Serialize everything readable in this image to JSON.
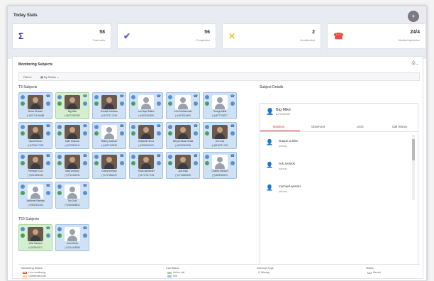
{
  "header": {
    "title": "Today Stats"
  },
  "stats": [
    {
      "icon": "sigma-icon",
      "glyph": "Σ",
      "color": "#2f3a8f",
      "value": "58",
      "label": "Total calls"
    },
    {
      "icon": "check-icon",
      "glyph": "✔",
      "color": "#6a5acd",
      "value": "56",
      "label": "Completed"
    },
    {
      "icon": "missed-call-icon",
      "glyph": "✕",
      "color": "#f0c330",
      "value": "2",
      "label": "Unattended"
    },
    {
      "icon": "phone-active-icon",
      "glyph": "☎",
      "color": "#e74c3c",
      "value": "24/4",
      "label": "Monitoring/Active"
    }
  ],
  "monitoring": {
    "title": "Monitoring Subjects",
    "filters_label": "Filters:",
    "filter_value": "By Status"
  },
  "t3": {
    "title": "T3 Subjects",
    "subjects": [
      {
        "name": "Bruno Richard",
        "number": "(+)972716 66488",
        "green": false,
        "real": true
      },
      {
        "name": "Big Mike",
        "number": "(+)9172930782",
        "green": true,
        "real": true
      },
      {
        "name": "Ronald Goldman",
        "number": "(+)972717 2100",
        "green": false,
        "real": true
      },
      {
        "name": "Lee Boyd Malvo",
        "number": "(+)4874392289",
        "green": false,
        "real": false
      },
      {
        "name": "John Muhammad",
        "number": "(+)4873910455",
        "green": false,
        "real": false
      },
      {
        "name": "George Millie",
        "number": "(+)4877728227",
        "green": false,
        "real": false
      },
      {
        "name": "Nicole Brown",
        "number": "(+)972943 7299",
        "green": false,
        "real": true
      },
      {
        "name": "Katie Simpson",
        "number": "(+)9722816111",
        "green": false,
        "real": true
      },
      {
        "name": "Britney Jackson",
        "number": "(+)4874763228",
        "green": false,
        "real": false
      },
      {
        "name": "Elizabeth Short",
        "number": "(+)5319601122",
        "green": false,
        "real": true
      },
      {
        "name": "Meryah Black Selda",
        "number": "(+)5319381288",
        "green": false,
        "real": true
      },
      {
        "name": "Ted Cruz",
        "number": "(+)5318721 200",
        "green": false,
        "real": true
      },
      {
        "name": "Penelope Cruz",
        "number": "(+)5312891544",
        "green": false,
        "real": true
      },
      {
        "name": "Mary Anthony",
        "number": "(+)2712460011",
        "green": false,
        "real": true
      },
      {
        "name": "Casey Anthony",
        "number": "(+)2717882122",
        "green": false,
        "real": true
      },
      {
        "name": "Travis Alexander",
        "number": "(+)2717917 233",
        "green": false,
        "real": true
      },
      {
        "name": "Jodi Arias",
        "number": "(+)2713883155",
        "green": false,
        "real": true
      },
      {
        "name": "Charles Manson",
        "number": "(+)2839354220",
        "green": false,
        "real": false
      },
      {
        "name": "JonBenet Ramsey",
        "number": "(+)2833311344",
        "green": false,
        "real": false
      },
      {
        "name": "Ted Gold",
        "number": "(+)2834566812",
        "green": false,
        "real": false
      }
    ]
  },
  "t50": {
    "title": "T50 Subjects",
    "subjects": [
      {
        "name": "John Dawson",
        "number": "(+)312843171",
        "green": true,
        "real": true
      },
      {
        "name": "Josh Martin",
        "number": "(+)3214445555",
        "green": false,
        "real": false
      }
    ]
  },
  "details": {
    "title": "Subject Details",
    "name": "Big Mike",
    "number": "9172930782",
    "tabs": [
      "Monitors",
      "Observers",
      "LIOS",
      "Call History"
    ],
    "monitors": [
      {
        "name": "isaque.a.leite",
        "role": "primary"
      },
      {
        "name": "rick.zemlok",
        "role": "backup"
      },
      {
        "name": "michael.werner",
        "role": "primary"
      }
    ]
  },
  "legend": {
    "monitoring_status": {
      "title": "Monitoring Status",
      "items": [
        {
          "label": "Live monitoring",
          "color": "#e74c3c"
        },
        {
          "label": "Unattended call",
          "color": "#f5d76e"
        }
      ]
    },
    "call_status": {
      "title": "Call Status",
      "items": [
        {
          "label": "Active call",
          "color": "#a7d39c"
        },
        {
          "label": "Idle",
          "color": "#9fc0e4"
        }
      ]
    },
    "intercept_type": {
      "title": "Intercept Type",
      "items": [
        {
          "label": "Wiretap"
        }
      ]
    },
    "status": {
      "title": "Status",
      "items": [
        {
          "label": "Barred"
        }
      ]
    }
  }
}
